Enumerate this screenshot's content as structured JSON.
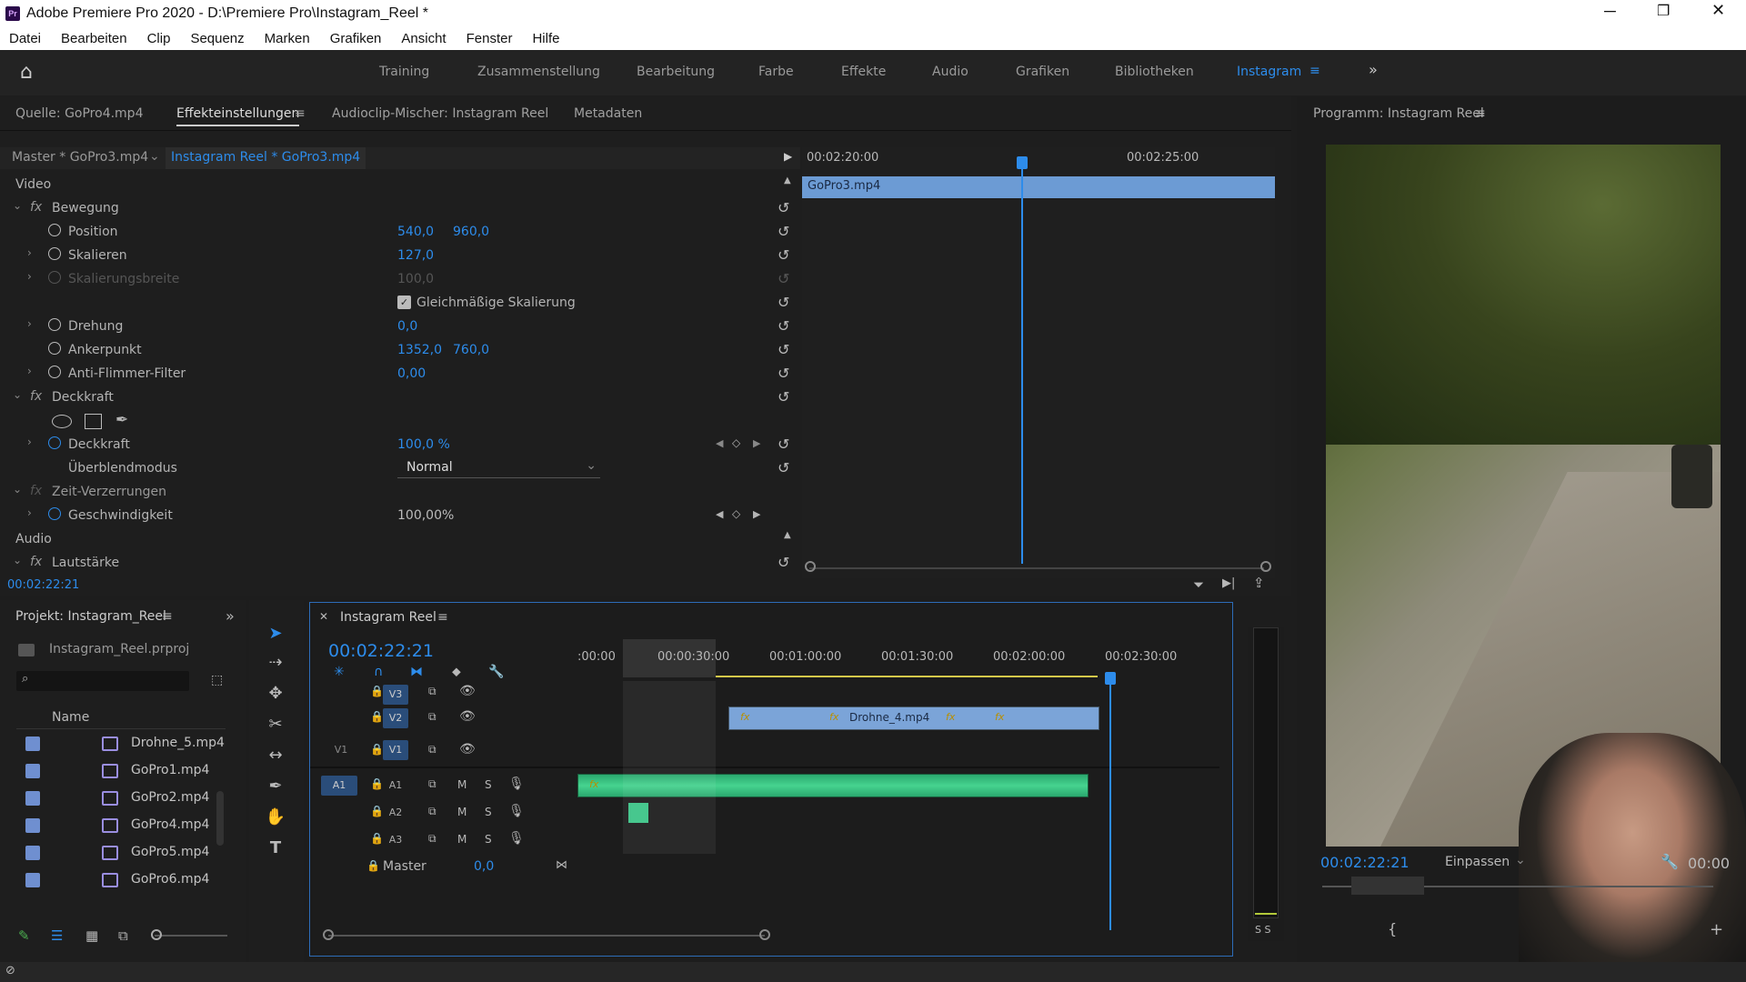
{
  "window": {
    "title": "Adobe Premiere Pro 2020 - D:\\Premiere Pro\\Instagram_Reel *",
    "app_icon": "Pr"
  },
  "menu": [
    "Datei",
    "Bearbeiten",
    "Clip",
    "Sequenz",
    "Marken",
    "Grafiken",
    "Ansicht",
    "Fenster",
    "Hilfe"
  ],
  "workspaces": [
    "Training",
    "Zusammenstellung",
    "Bearbeitung",
    "Farbe",
    "Effekte",
    "Audio",
    "Grafiken",
    "Bibliotheken",
    "Instagram"
  ],
  "active_workspace": "Instagram",
  "source_tabs": [
    "Quelle: GoPro4.mp4",
    "Effekteinstellungen",
    "Audioclip-Mischer: Instagram Reel",
    "Metadaten"
  ],
  "effect_controls": {
    "master": "Master * GoPro3.mp4",
    "sequence_clip": "Instagram Reel * GoPro3.mp4",
    "ruler": [
      "00:02:20:00",
      "00:02:25:00"
    ],
    "clip_name": "GoPro3.mp4",
    "section_video": "Video",
    "section_audio": "Audio",
    "motion": "Bewegung",
    "position": {
      "label": "Position",
      "x": "540,0",
      "y": "960,0"
    },
    "scale": {
      "label": "Skalieren",
      "value": "127,0"
    },
    "scale_width": {
      "label": "Skalierungsbreite",
      "value": "100,0"
    },
    "uniform_scale": "Gleichmäßige Skalierung",
    "rotation": {
      "label": "Drehung",
      "value": "0,0"
    },
    "anchor": {
      "label": "Ankerpunkt",
      "x": "1352,0",
      "y": "760,0"
    },
    "antiflicker": {
      "label": "Anti-Flimmer-Filter",
      "value": "0,00"
    },
    "opacity_group": "Deckkraft",
    "opacity": {
      "label": "Deckkraft",
      "value": "100,0 %"
    },
    "blend": {
      "label": "Überblendmodus",
      "value": "Normal"
    },
    "time_remap": "Zeit-Verzerrungen",
    "speed": {
      "label": "Geschwindigkeit",
      "value": "100,00%"
    },
    "volume": "Lautstärke",
    "timecode": "00:02:22:21"
  },
  "program": {
    "title": "Programm: Instagram Reel",
    "timecode": "00:02:22:21",
    "fit": "Einpassen",
    "right_tc": "00:00"
  },
  "project": {
    "title": "Projekt: Instagram_Reel",
    "file": "Instagram_Reel.prproj",
    "column": "Name",
    "items": [
      "Drohne_5.mp4",
      "GoPro1.mp4",
      "GoPro2.mp4",
      "GoPro4.mp4",
      "GoPro5.mp4",
      "GoPro6.mp4"
    ]
  },
  "timeline": {
    "title": "Instagram Reel",
    "timecode": "00:02:22:21",
    "ruler": [
      ":00:00",
      "00:00:30:00",
      "00:01:00:00",
      "00:01:30:00",
      "00:02:00:00",
      "00:02:30:00"
    ],
    "video_tracks": [
      "V3",
      "V2",
      "V1"
    ],
    "audio_tracks": [
      "A1",
      "A2",
      "A3"
    ],
    "src_v": "V1",
    "src_a": "A1",
    "master": "Master",
    "master_value": "0,0",
    "clip_label": "Drohne_4.mp4",
    "fx": "fx",
    "m": "M",
    "s": "S"
  },
  "meter": {
    "labels": "S S"
  }
}
